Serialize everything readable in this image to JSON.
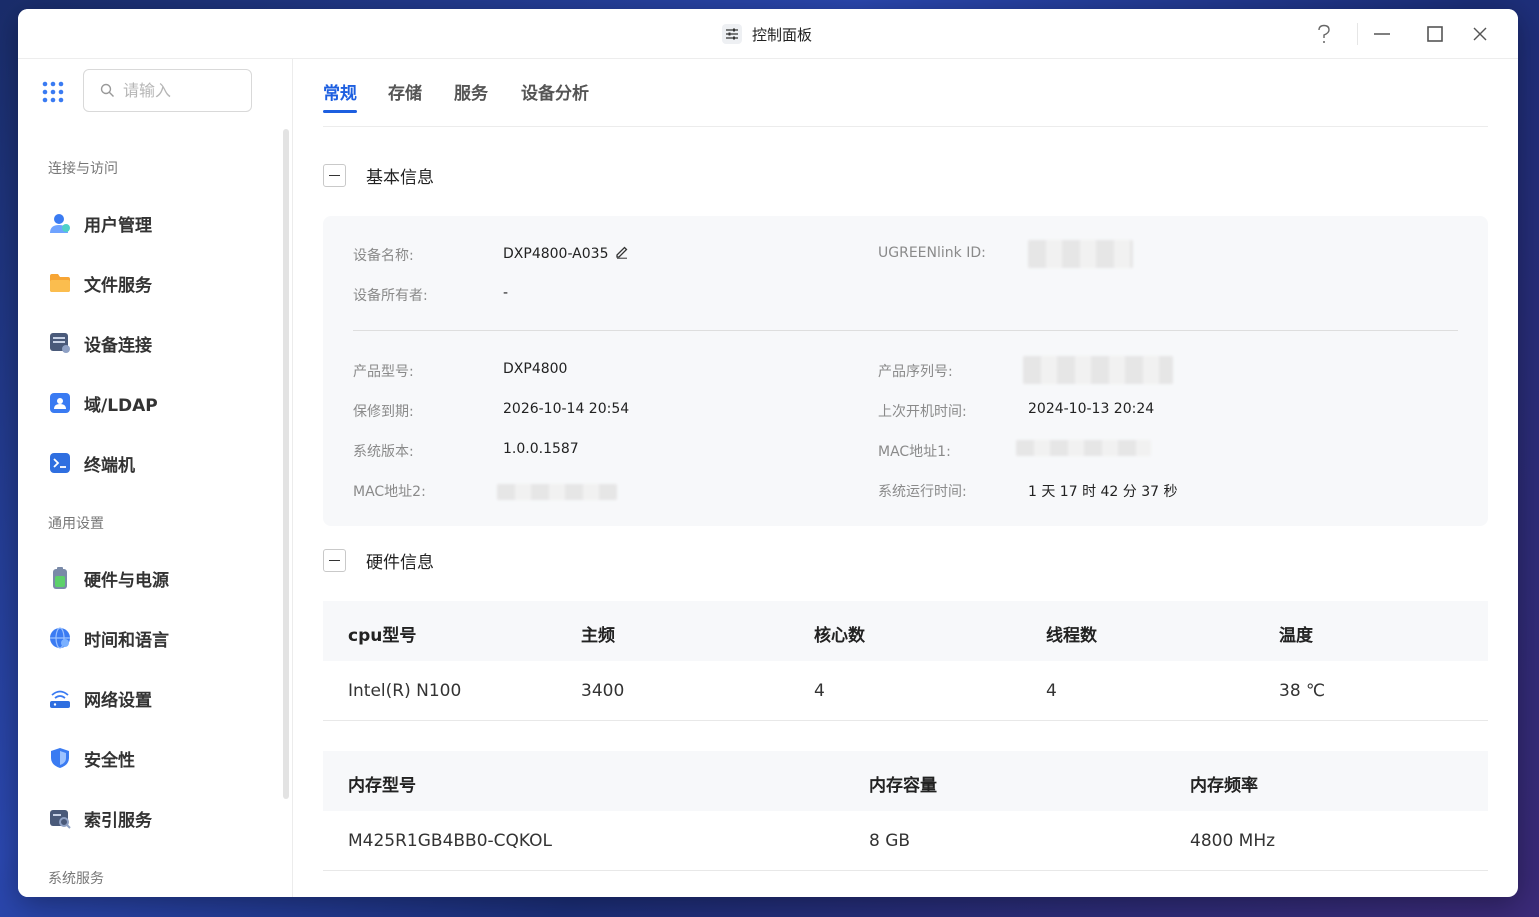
{
  "window": {
    "title": "控制面板"
  },
  "sidebar": {
    "search_placeholder": "请输入",
    "groups": [
      {
        "title": "连接与访问"
      },
      {
        "title": "通用设置"
      },
      {
        "title": "系统服务"
      }
    ],
    "items": [
      {
        "label": "用户管理",
        "icon": "user-management-icon"
      },
      {
        "label": "文件服务",
        "icon": "folder-icon"
      },
      {
        "label": "设备连接",
        "icon": "device-connect-icon"
      },
      {
        "label": "域/LDAP",
        "icon": "ldap-icon"
      },
      {
        "label": "终端机",
        "icon": "terminal-icon"
      },
      {
        "label": "硬件与电源",
        "icon": "battery-icon"
      },
      {
        "label": "时间和语言",
        "icon": "globe-icon"
      },
      {
        "label": "网络设置",
        "icon": "network-icon"
      },
      {
        "label": "安全性",
        "icon": "shield-icon"
      },
      {
        "label": "索引服务",
        "icon": "index-icon"
      }
    ]
  },
  "tabs": [
    {
      "label": "常规",
      "active": true
    },
    {
      "label": "存储"
    },
    {
      "label": "服务"
    },
    {
      "label": "设备分析"
    }
  ],
  "basic_info": {
    "title": "基本信息",
    "device_name_label": "设备名称:",
    "device_name": "DXP4800-A035",
    "ugreenlink_label": "UGREENlink ID:",
    "owner_label": "设备所有者:",
    "owner": "-",
    "model_label": "产品型号:",
    "model": "DXP4800",
    "serial_label": "产品序列号:",
    "warranty_label": "保修到期:",
    "warranty": "2026-10-14 20:54",
    "last_boot_label": "上次开机时间:",
    "last_boot": "2024-10-13 20:24",
    "os_version_label": "系统版本:",
    "os_version": "1.0.0.1587",
    "mac1_label": "MAC地址1:",
    "mac2_label": "MAC地址2:",
    "uptime_label": "系统运行时间:",
    "uptime": "1 天 17 时 42 分 37 秒"
  },
  "hardware_info": {
    "title": "硬件信息",
    "cpu_headers": [
      "cpu型号",
      "主频",
      "核心数",
      "线程数",
      "温度"
    ],
    "cpu_row": [
      "Intel(R) N100",
      "3400",
      "4",
      "4",
      "38 ℃"
    ],
    "mem_headers": [
      "内存型号",
      "内存容量",
      "内存频率"
    ],
    "mem_row": [
      "M425R1GB4BB0-CQKOL",
      "8 GB",
      "4800 MHz"
    ]
  },
  "colors": {
    "accent": "#1d5fe0",
    "card_bg": "#f7f8fa"
  }
}
